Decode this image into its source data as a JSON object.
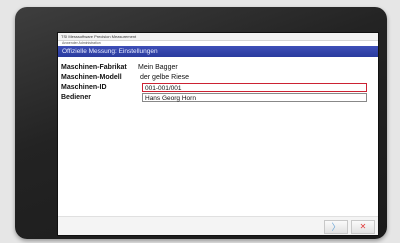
{
  "window": {
    "title": "TSI Messsoftware Precision Measurement",
    "subtitle": "Anwender Administration"
  },
  "header": {
    "title": "Offizielle Messung: Einstellungen"
  },
  "form": {
    "fields": [
      {
        "label": "Maschinen-Fabrikat",
        "value": "Mein Bagger"
      },
      {
        "label": "Maschinen-Modell",
        "value": "der gelbe Riese"
      },
      {
        "label": "Maschinen-ID",
        "value": "001-001/001"
      },
      {
        "label": "Bediener",
        "value": "Hans Georg Horn"
      }
    ]
  },
  "buttons": {
    "next_icon": "chevron-right-icon",
    "next_glyph": "〉",
    "cancel_icon": "close-icon",
    "cancel_glyph": "✕"
  },
  "colors": {
    "header_bg": "#2e3fa6",
    "active_field_border": "#cc2233",
    "cancel": "#e23b3b",
    "next": "#6aa6d8"
  }
}
